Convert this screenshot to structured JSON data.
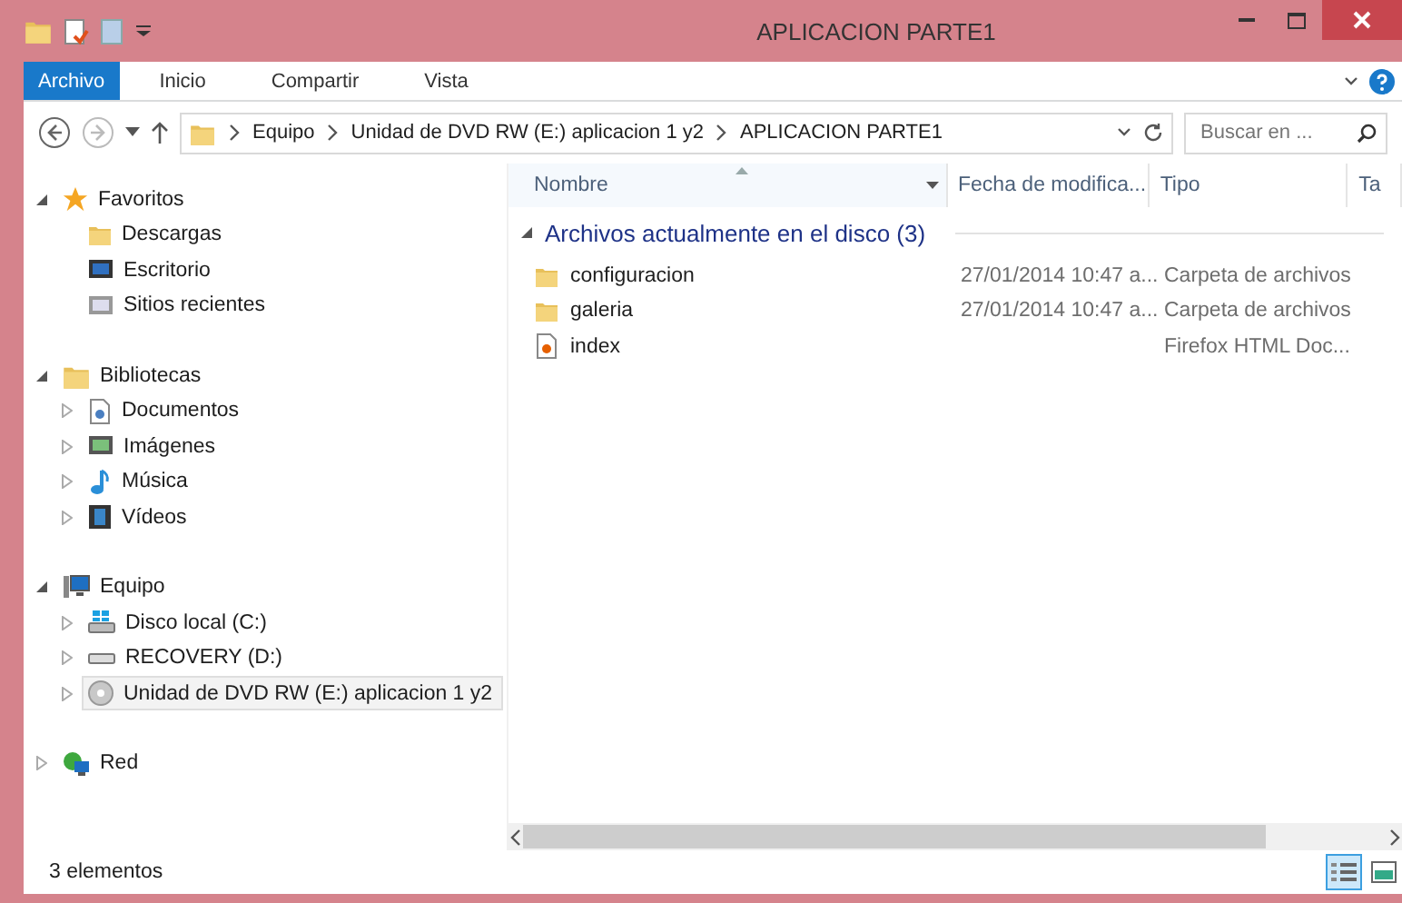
{
  "window": {
    "title": "APLICACION PARTE1"
  },
  "ribbon_tabs": [
    {
      "label": "Archivo",
      "selected": true
    },
    {
      "label": "Inicio",
      "selected": false
    },
    {
      "label": "Compartir",
      "selected": false
    },
    {
      "label": "Vista",
      "selected": false
    }
  ],
  "address_bar": {
    "path": [
      "Equipo",
      "Unidad de DVD RW (E:) aplicacion 1 y2",
      "APLICACION PARTE1"
    ]
  },
  "search": {
    "placeholder": "Buscar en ..."
  },
  "sidebar": {
    "groups": [
      {
        "label": "Favoritos",
        "expanded": true,
        "children": [
          {
            "label": "Descargas",
            "selected": false
          },
          {
            "label": "Escritorio",
            "selected": false
          },
          {
            "label": "Sitios recientes",
            "selected": false
          }
        ]
      },
      {
        "label": "Bibliotecas",
        "expanded": true,
        "children": [
          {
            "label": "Documentos",
            "selected": false,
            "expanded": false
          },
          {
            "label": "Imágenes",
            "selected": false,
            "expanded": false
          },
          {
            "label": "Música",
            "selected": false,
            "expanded": false
          },
          {
            "label": "Vídeos",
            "selected": false,
            "expanded": false
          }
        ]
      },
      {
        "label": "Equipo",
        "expanded": true,
        "children": [
          {
            "label": "Disco local (C:)",
            "selected": false,
            "expanded": false
          },
          {
            "label": "RECOVERY (D:)",
            "selected": false,
            "expanded": false
          },
          {
            "label": "Unidad de DVD RW (E:) aplicacion 1 y2",
            "selected": true,
            "expanded": false
          }
        ]
      },
      {
        "label": "Red",
        "expanded": false
      }
    ]
  },
  "table": {
    "columns": [
      "Nombre",
      "Fecha de modifica...",
      "Tipo",
      "Ta"
    ],
    "group": {
      "label": "Archivos actualmente en el disco (3)",
      "expanded": true
    },
    "rows": [
      {
        "kind": "folder",
        "name": "configuracion",
        "date": "27/01/2014 10:47 a...",
        "type": "Carpeta de archivos"
      },
      {
        "kind": "folder",
        "name": "galeria",
        "date": "27/01/2014 10:47 a...",
        "type": "Carpeta de archivos"
      },
      {
        "kind": "html",
        "name": "index",
        "type": "Firefox HTML Doc..."
      }
    ]
  },
  "status_bar": {
    "count": "3 elementos",
    "views": [
      {
        "kind": "details",
        "selected": true
      },
      {
        "kind": "large_icons",
        "selected": false
      }
    ]
  }
}
